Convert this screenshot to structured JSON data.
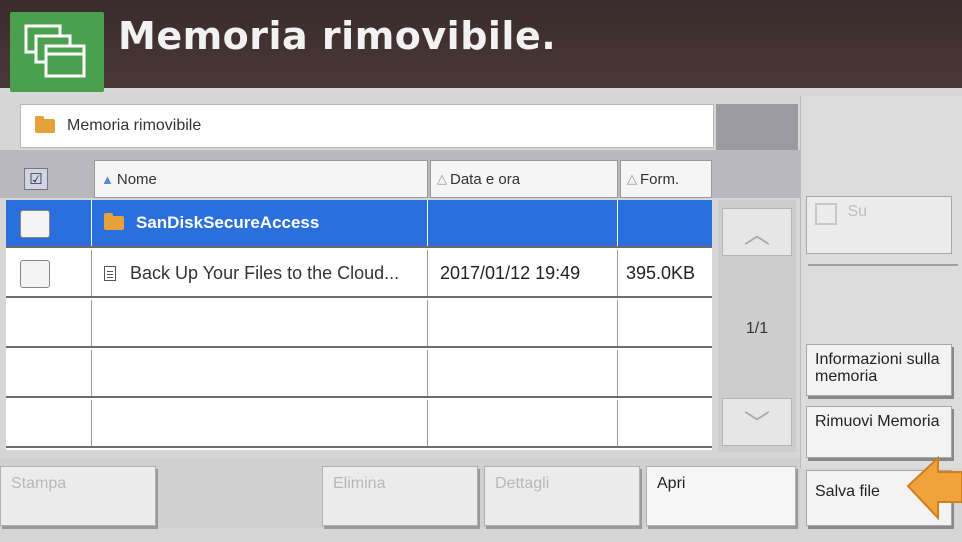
{
  "header": {
    "title": "Memoria rimovibile."
  },
  "path": {
    "label": "Memoria rimovibile"
  },
  "columns": {
    "name": "Nome",
    "date": "Data e ora",
    "format": "Form."
  },
  "rows": [
    {
      "name": "SanDiskSecureAccess",
      "date": "",
      "size": "",
      "type": "folder",
      "selected": true
    },
    {
      "name": "Back Up Your Files to the Cloud...",
      "date": "2017/01/12 19:49",
      "size": "395.0KB",
      "type": "file",
      "selected": false
    }
  ],
  "pager": {
    "indicator": "1/1"
  },
  "side_buttons": {
    "up": "Su",
    "memory_info": "Informazioni sulla memoria",
    "remove_memory": "Rimuovi Memoria",
    "save_file": "Salva file"
  },
  "bottom_buttons": {
    "print": "Stampa",
    "delete": "Elimina",
    "details": "Dettagli",
    "open": "Apri"
  },
  "colors": {
    "header": "#3a2c2c",
    "accent_green": "#4aa04c",
    "selection": "#2a6fdc",
    "arrow": "#f0a23c"
  }
}
